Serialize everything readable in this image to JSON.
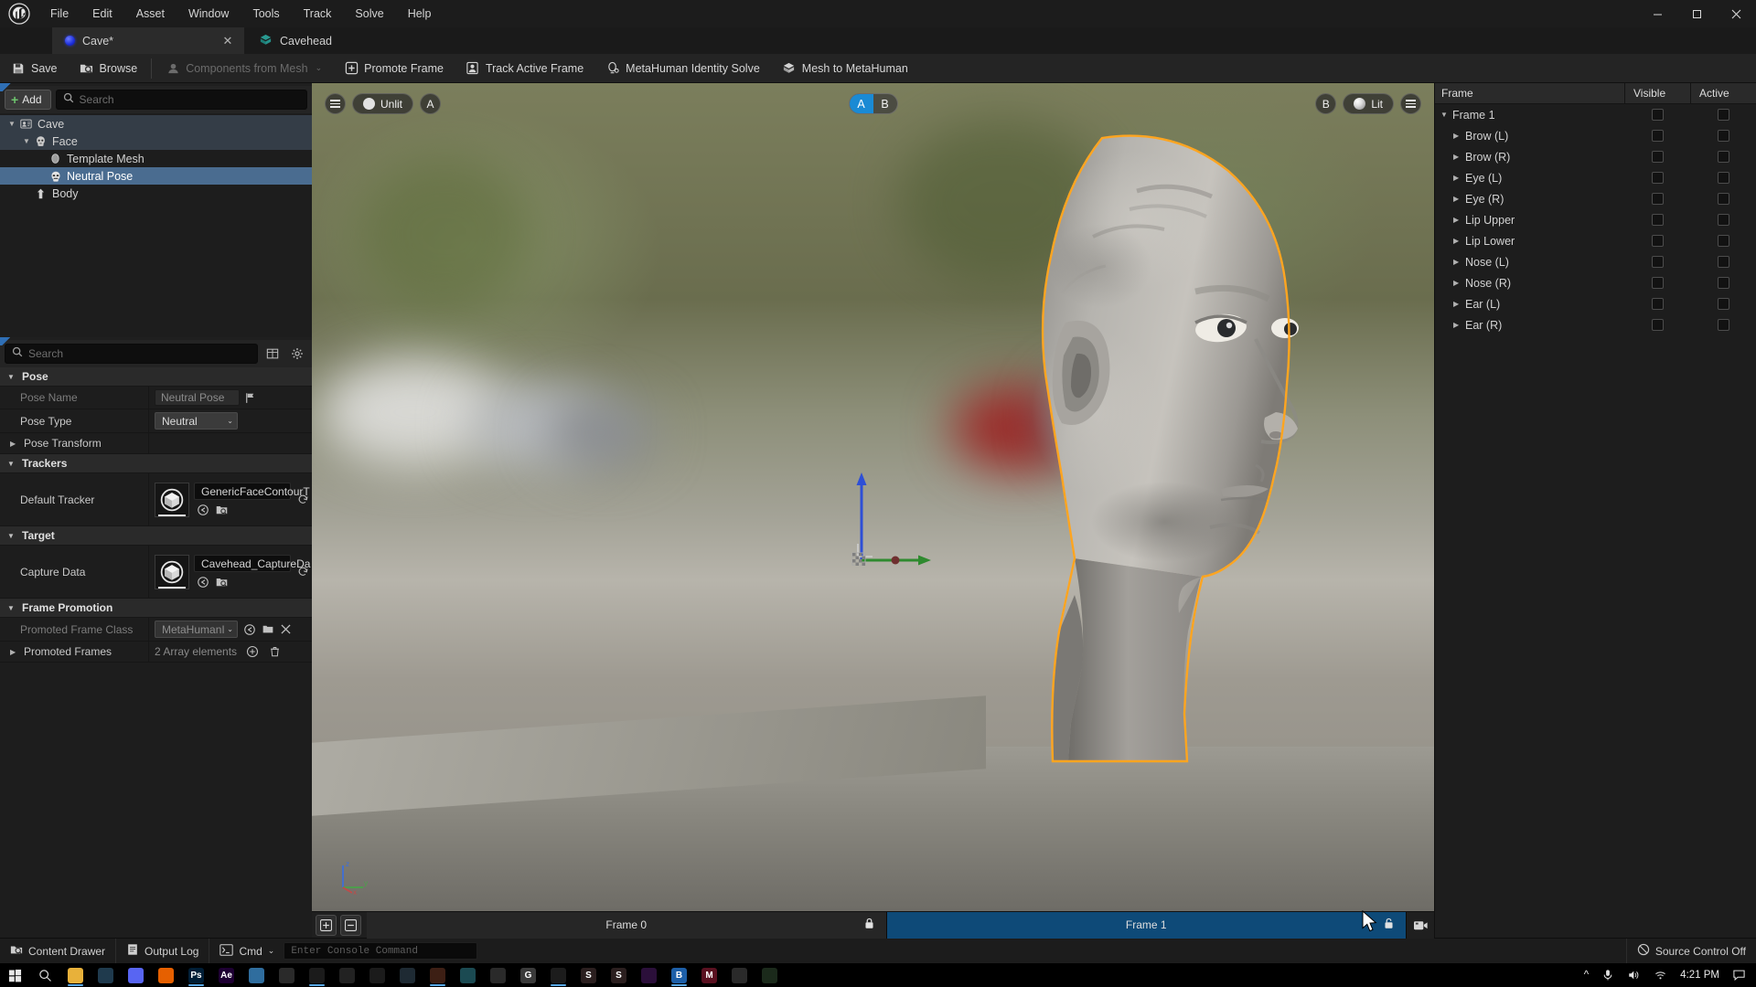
{
  "window": {
    "controls": {
      "minimize": "–",
      "maximize": "□",
      "close": "✕"
    }
  },
  "menubar": {
    "logo": "unreal-engine-logo",
    "items": [
      "File",
      "Edit",
      "Asset",
      "Window",
      "Tools",
      "Track",
      "Solve",
      "Help"
    ]
  },
  "tabs": [
    {
      "label": "Cave*",
      "icon": "blueprint-sphere-icon",
      "active": true,
      "close": "✕"
    },
    {
      "label": "Cavehead",
      "icon": "static-mesh-icon",
      "active": false
    }
  ],
  "toolbar": {
    "items": [
      {
        "label": "Save",
        "icon": "save-icon",
        "disabled": false
      },
      {
        "label": "Browse",
        "icon": "browse-icon",
        "disabled": false
      },
      {
        "label": "Components from Mesh",
        "icon": "components-from-mesh-icon",
        "disabled": true,
        "caret": "⌄"
      },
      {
        "label": "Promote Frame",
        "icon": "promote-frame-icon",
        "disabled": false
      },
      {
        "label": "Track Active Frame",
        "icon": "track-active-frame-icon",
        "disabled": false
      },
      {
        "label": "MetaHuman Identity Solve",
        "icon": "metahuman-identity-solve-icon",
        "disabled": false
      },
      {
        "label": "Mesh to MetaHuman",
        "icon": "mesh-to-metahuman-icon",
        "disabled": false
      }
    ]
  },
  "outliner": {
    "add_label": "Add",
    "search_placeholder": "Search",
    "tree": [
      {
        "label": "Cave",
        "depth": 0,
        "icon": "identity-icon",
        "expander": "▼",
        "state": "hl"
      },
      {
        "label": "Face",
        "depth": 1,
        "icon": "face-part-icon",
        "expander": "▼",
        "state": "hl"
      },
      {
        "label": "Template Mesh",
        "depth": 2,
        "icon": "template-mesh-icon",
        "expander": "",
        "state": ""
      },
      {
        "label": "Neutral Pose",
        "depth": 2,
        "icon": "neutral-pose-icon",
        "expander": "",
        "state": "sel"
      },
      {
        "label": "Body",
        "depth": 1,
        "icon": "body-part-icon",
        "expander": "",
        "state": ""
      }
    ]
  },
  "details": {
    "search_placeholder": "Search",
    "grid_icon": "column-layout-icon",
    "settings_icon": "gear-icon",
    "sections": [
      {
        "title": "Pose",
        "expanded": true,
        "rows": [
          {
            "name": "Pose Name",
            "type": "text",
            "value": "Neutral Pose",
            "dim": true,
            "badge": "flag-icon"
          },
          {
            "name": "Pose Type",
            "type": "combo",
            "value": "Neutral",
            "dim": false
          },
          {
            "name": "Pose Transform",
            "type": "empty",
            "value": "",
            "expander": "▶"
          }
        ]
      },
      {
        "title": "Trackers",
        "expanded": true,
        "rows": [
          {
            "name": "Default Tracker",
            "type": "asset",
            "value": "GenericFaceContourT",
            "thumb": "tracker-thumbnail",
            "reset": "↩"
          }
        ]
      },
      {
        "title": "Target",
        "expanded": true,
        "rows": [
          {
            "name": "Capture Data",
            "type": "asset",
            "value": "Cavehead_CaptureDa",
            "thumb": "capture-data-thumbnail",
            "reset": "↩"
          }
        ]
      },
      {
        "title": "Frame Promotion",
        "expanded": true,
        "rows": [
          {
            "name": "Promoted Frame Class",
            "type": "combo-extra",
            "value": "MetaHumanIdent",
            "dim": true
          },
          {
            "name": "Promoted Frames",
            "type": "array",
            "value": "2 Array elements",
            "expander": "▶"
          }
        ]
      }
    ]
  },
  "viewport": {
    "left_menu_icon": "viewport-menu-icon",
    "left_mode_label": "Unlit",
    "left_mode_icon": "unlit-sphere-icon",
    "left_letter": "A",
    "right_letter": "B",
    "right_mode_label": "Lit",
    "right_mode_icon": "lit-sphere-icon",
    "right_menu_icon": "viewport-menu-icon",
    "ab_toggle": {
      "options": [
        "A",
        "B"
      ],
      "selected": "A"
    },
    "gizmo_axes": [
      "z",
      "y",
      "x"
    ],
    "selection_outline_color": "#ffa520"
  },
  "timeline": {
    "add_icon": "add-frame-icon",
    "remove_icon": "remove-frame-icon",
    "frames": [
      {
        "label": "Frame 0",
        "active": false,
        "lock": "lock-closed-icon"
      },
      {
        "label": "Frame 1",
        "active": true,
        "lock": "lock-open-icon"
      }
    ],
    "camera_icon": "camera-icon"
  },
  "frame_panel": {
    "columns": [
      "Frame",
      "Visible",
      "Active"
    ],
    "rows": [
      {
        "label": "Frame 1",
        "depth": 0,
        "expander": "▼",
        "visible": false,
        "active": false
      },
      {
        "label": "Brow (L)",
        "depth": 1,
        "expander": "▶",
        "visible": false,
        "active": false
      },
      {
        "label": "Brow (R)",
        "depth": 1,
        "expander": "▶",
        "visible": false,
        "active": false
      },
      {
        "label": "Eye (L)",
        "depth": 1,
        "expander": "▶",
        "visible": false,
        "active": false
      },
      {
        "label": "Eye (R)",
        "depth": 1,
        "expander": "▶",
        "visible": false,
        "active": false
      },
      {
        "label": "Lip Upper",
        "depth": 1,
        "expander": "▶",
        "visible": false,
        "active": false
      },
      {
        "label": "Lip Lower",
        "depth": 1,
        "expander": "▶",
        "visible": false,
        "active": false
      },
      {
        "label": "Nose (L)",
        "depth": 1,
        "expander": "▶",
        "visible": false,
        "active": false
      },
      {
        "label": "Nose (R)",
        "depth": 1,
        "expander": "▶",
        "visible": false,
        "active": false
      },
      {
        "label": "Ear (L)",
        "depth": 1,
        "expander": "▶",
        "visible": false,
        "active": false
      },
      {
        "label": "Ear (R)",
        "depth": 1,
        "expander": "▶",
        "visible": false,
        "active": false
      }
    ]
  },
  "statusbar": {
    "content_drawer": "Content Drawer",
    "content_drawer_icon": "drawer-icon",
    "output_log": "Output Log",
    "output_log_icon": "log-icon",
    "cmd_label": "Cmd",
    "cmd_icon": "console-icon",
    "cmd_caret": "⌄",
    "console_placeholder": "Enter Console Command",
    "source_control": "Source Control Off",
    "source_control_icon": "no-source-control-icon"
  },
  "taskbar": {
    "start_icon": "windows-start-icon",
    "search_icon": "search-icon",
    "apps": [
      {
        "name": "file-explorer-icon",
        "color": "#e8b13a",
        "glyph": ""
      },
      {
        "name": "steam-icon",
        "color": "#1f3a4d",
        "glyph": ""
      },
      {
        "name": "discord-icon",
        "color": "#5865f2",
        "glyph": ""
      },
      {
        "name": "firefox-icon",
        "color": "#e66000",
        "glyph": ""
      },
      {
        "name": "photoshop-icon",
        "color": "#001e36",
        "glyph": "Ps"
      },
      {
        "name": "after-effects-icon",
        "color": "#1e0033",
        "glyph": "Ae"
      },
      {
        "name": "media-player-icon",
        "color": "#2f6d9e",
        "glyph": ""
      },
      {
        "name": "krita-icon",
        "color": "#2a2a2a",
        "glyph": ""
      },
      {
        "name": "vlc-icon",
        "color": "#1b1b1b",
        "glyph": ""
      },
      {
        "name": "lightning-icon",
        "color": "#222222",
        "glyph": ""
      },
      {
        "name": "blender-icon",
        "color": "#1b1b1b",
        "glyph": ""
      },
      {
        "name": "godot-icon",
        "color": "#1e2a33",
        "glyph": ""
      },
      {
        "name": "substance-icon",
        "color": "#3d1f14",
        "glyph": ""
      },
      {
        "name": "browser-icon",
        "color": "#1b4a52",
        "glyph": ""
      },
      {
        "name": "runner-icon",
        "color": "#2a2a2a",
        "glyph": ""
      },
      {
        "name": "gimp-icon",
        "color": "#3a3a3a",
        "glyph": "G"
      },
      {
        "name": "houdini-icon",
        "color": "#1c1c1c",
        "glyph": ""
      },
      {
        "name": "substance-painter-icon",
        "color": "#2b1f1f",
        "glyph": "S"
      },
      {
        "name": "substance-designer-icon",
        "color": "#2b1f1f",
        "glyph": "S"
      },
      {
        "name": "github-icon",
        "color": "#2b0f3a",
        "glyph": ""
      },
      {
        "name": "bridge-icon",
        "color": "#1d5fa8",
        "glyph": "B"
      },
      {
        "name": "marmoset-icon",
        "color": "#5a1020",
        "glyph": "M"
      },
      {
        "name": "unreal-engine-icon",
        "color": "#2a2a2a",
        "glyph": ""
      },
      {
        "name": "mountain-app-icon",
        "color": "#1b2a1b",
        "glyph": ""
      }
    ],
    "tray": {
      "chevron": "^",
      "mic_icon": "microphone-icon",
      "volume_icon": "volume-icon",
      "wifi_icon": "wifi-icon",
      "clock": "4:21 PM",
      "notifications_icon": "notification-icon"
    }
  }
}
